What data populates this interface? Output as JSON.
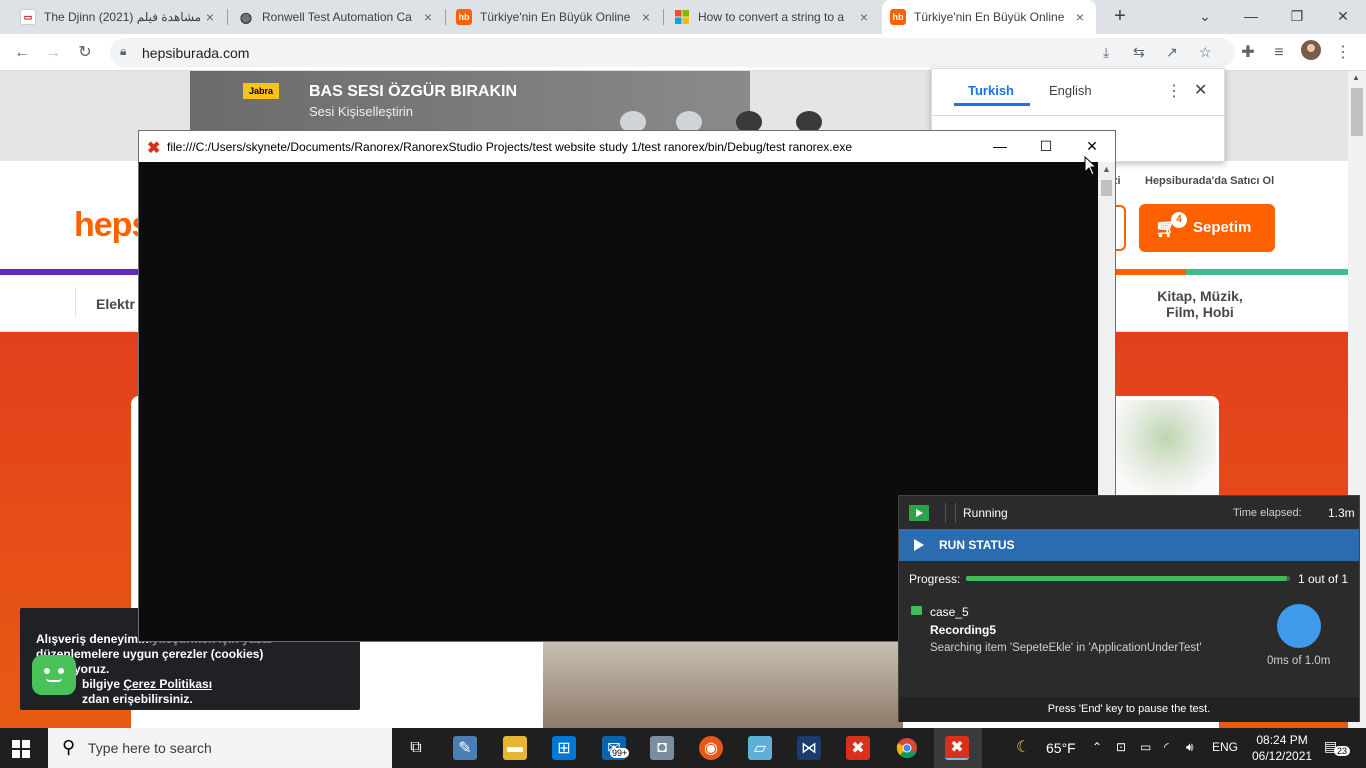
{
  "browser": {
    "tabs": [
      {
        "title": "The Djinn (2021) مشاهدة فيلم",
        "favicon": "page-favicon"
      },
      {
        "title": "Ronwell Test Automation Ca",
        "favicon": "globe-favicon"
      },
      {
        "title": "Türkiye'nin En Büyük Online",
        "favicon": "hb-favicon"
      },
      {
        "title": "How to convert a string to a",
        "favicon": "microsoft-favicon"
      },
      {
        "title": "Türkiye'nin En Büyük Online",
        "favicon": "hb-favicon",
        "active": true
      }
    ],
    "favicon_text": "hb",
    "address": "hepsiburada.com"
  },
  "page": {
    "ad_brand": "Jabra",
    "ad_headline": "BAS SESI ÖZGÜR BIRAKIN",
    "ad_subline": "Sesi Kişiselleştirin",
    "logo_text": "heps",
    "top_link_partial": "zi",
    "seller_link": "Hepsiburada'da Satıcı Ol",
    "cart_label": "Sepetim",
    "cart_count": "4",
    "categories": [
      "Elektr",
      "Kitap, Müzik,",
      "Film, Hobi"
    ]
  },
  "cookie": {
    "line1": "Alışveriş deneyimin",
    "line1b": "iyileştirmek için yasal",
    "line2": "düzenlemelere uygun çerezler (cookies) kullanıyoruz.",
    "line3a": "bilgiye ",
    "policy_link": "Çerez Politikası",
    "line4": "zdan erişebilirsiniz."
  },
  "translate": {
    "lang_active": "Turkish",
    "lang_other": "English"
  },
  "console": {
    "title": "file:///C:/Users/skynete/Documents/Ranorex/RanorexStudio Projects/test website study 1/test ranorex/bin/Debug/test ranorex.exe"
  },
  "ranorex": {
    "state": "Running",
    "elapsed_label": "Time elapsed:",
    "elapsed_value": "1.3m",
    "run_status": "RUN STATUS",
    "progress_label": "Progress:",
    "progress_fraction": 0.99,
    "progress_count": "1 out of 1",
    "case_name": "case_5",
    "recording": "Recording5",
    "searching": "Searching item 'SepeteEkle' in 'ApplicationUnderTest'",
    "timer": "0ms of 1.0m",
    "footer": "Press 'End' key to pause the test."
  },
  "taskbar": {
    "search_placeholder": "Type here to search",
    "mail_badge": "99+",
    "weather": "65°F",
    "language": "ENG",
    "time": "08:24 PM",
    "date": "06/12/2021",
    "notification_count": "23"
  },
  "colors": {
    "brand_orange": "#ff6000",
    "ranorex_blue": "#2b6cb0",
    "progress_green": "#3fbc5a",
    "chrome_blue": "#1a73e8"
  }
}
